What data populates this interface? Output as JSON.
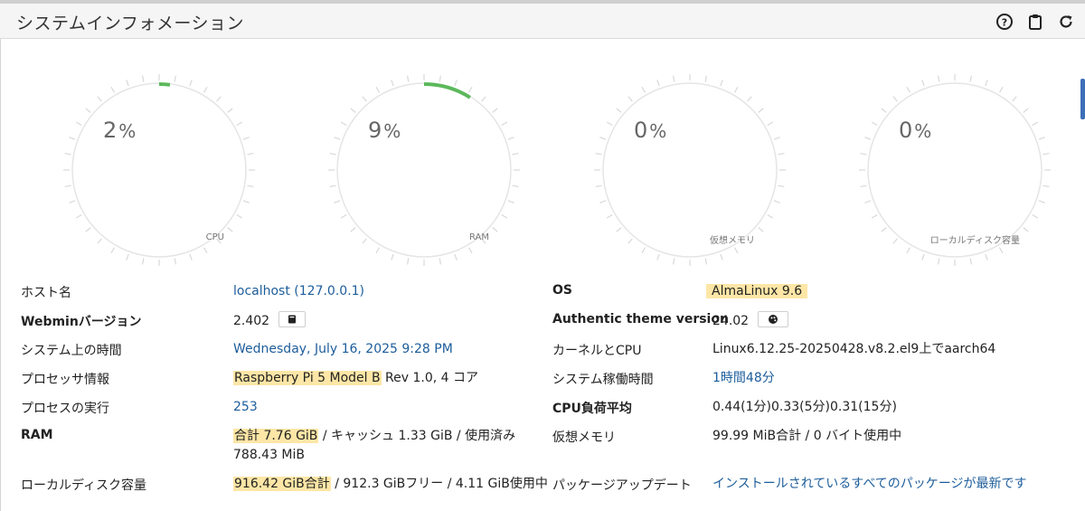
{
  "panel": {
    "title": "システムインフォメーション",
    "tools": [
      "help-icon",
      "clipboard-icon",
      "refresh-icon"
    ]
  },
  "gauges": [
    {
      "value": "2",
      "unit": "%",
      "label": "CPU",
      "percent": 2
    },
    {
      "value": "9",
      "unit": "%",
      "label": "RAM",
      "percent": 9
    },
    {
      "value": "0",
      "unit": "%",
      "label": "仮想メモリ",
      "percent": 0
    },
    {
      "value": "0",
      "unit": "%",
      "label": "ローカルディスク容量",
      "percent": 0
    }
  ],
  "colors": {
    "gauge_fill": "#5cb85c",
    "gauge_track": "#e5e5e5",
    "link": "#1d5d9b",
    "highlight": "#fde6a6"
  },
  "info_left": {
    "hostname_label": "ホスト名",
    "hostname_value": "localhost (127.0.0.1)",
    "webmin_label": "Webminバージョン",
    "webmin_value": "2.402",
    "time_label": "システム上の時間",
    "time_value": "Wednesday, July 16, 2025 9:28 PM",
    "cpu_label": "プロセッサ情報",
    "cpu_model": "Raspberry Pi 5 Model B",
    "cpu_rest": " Rev 1.0, 4 コア",
    "proc_label": "プロセスの実行",
    "proc_value": "253",
    "ram_label": "RAM",
    "ram_total": "合計 7.76 GiB",
    "ram_rest": " / キャッシュ 1.33 GiB / 使用済み",
    "ram_line2": "788.43 MiB",
    "disk_label": "ローカルディスク容量",
    "disk_total": "916.42 GiB合計",
    "disk_rest": " / 912.3 GiBフリー / 4.11 GiB使用中"
  },
  "info_right": {
    "os_label": "OS",
    "os_value": "AlmaLinux 9.6",
    "theme_label": "Authentic theme version",
    "theme_value": "24.02",
    "kernel_label": "カーネルとCPU",
    "kernel_value": "Linux6.12.25-20250428.v8.2.el9上でaarch64",
    "uptime_label": "システム稼働時間",
    "uptime_value": "1時間48分",
    "load_label": "CPU負荷平均",
    "load_value": "0.44(1分)0.33(5分)0.31(15分)",
    "vmem_label": "仮想メモリ",
    "vmem_value": "99.99 MiB合計 / 0 バイト使用中",
    "pkg_label": "パッケージアップデート",
    "pkg_value": "インストールされているすべてのパッケージが最新です"
  }
}
